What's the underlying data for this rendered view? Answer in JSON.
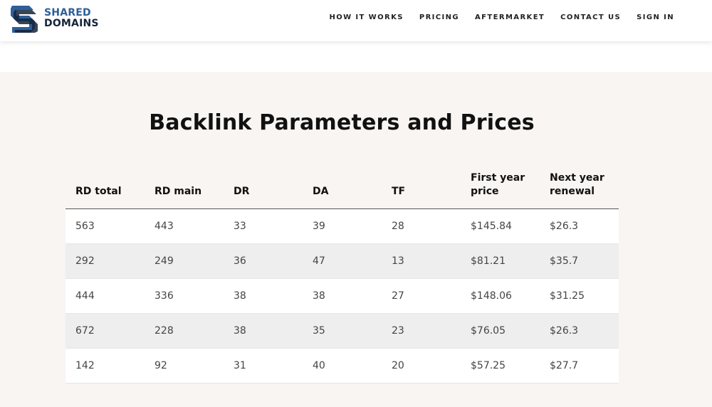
{
  "header": {
    "logo": {
      "line1": "SHARED",
      "line2": "DOMAINS"
    },
    "nav": [
      "HOW IT WORKS",
      "PRICING",
      "AFTERMARKET",
      "CONTACT US",
      "SIGN IN"
    ]
  },
  "main": {
    "title": "Backlink Parameters and Prices",
    "table": {
      "columns": [
        "RD total",
        "RD main",
        "DR",
        "DA",
        "TF",
        "First year price",
        "Next year renewal"
      ],
      "rows": [
        [
          "563",
          "443",
          "33",
          "39",
          "28",
          "$145.84",
          "$26.3"
        ],
        [
          "292",
          "249",
          "36",
          "47",
          "13",
          "$81.21",
          "$35.7"
        ],
        [
          "444",
          "336",
          "38",
          "38",
          "27",
          "$148.06",
          "$31.25"
        ],
        [
          "672",
          "228",
          "38",
          "35",
          "23",
          "$76.05",
          "$26.3"
        ],
        [
          "142",
          "92",
          "31",
          "40",
          "20",
          "$57.25",
          "$27.7"
        ]
      ]
    }
  },
  "colors": {
    "logo_blue": "#2d5f9a",
    "logo_navy": "#15233a",
    "section_bg": "#f8f5f2",
    "row_alt": "#eeeeee"
  }
}
